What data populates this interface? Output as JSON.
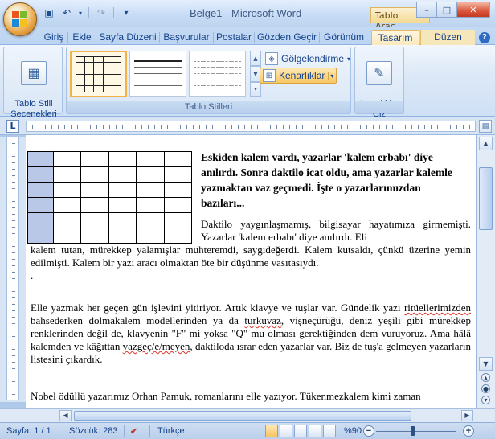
{
  "window": {
    "title": "Belge1 - Microsoft Word",
    "context_title": "Tablo Araç...",
    "min": "–",
    "max": "□",
    "close": "✕"
  },
  "qat": {
    "save_icon": "save-icon",
    "undo_icon": "undo-icon",
    "redo_icon": "redo-icon",
    "customize_icon": "customize-icon"
  },
  "tabs": [
    {
      "label": "Giriş"
    },
    {
      "label": "Ekle"
    },
    {
      "label": "Sayfa Düzeni"
    },
    {
      "label": "Başvurular"
    },
    {
      "label": "Postalar"
    },
    {
      "label": "Gözden Geçir"
    },
    {
      "label": "Görünüm"
    },
    {
      "label": "Tasarım",
      "active": true
    },
    {
      "label": "Düzen"
    }
  ],
  "ribbon": {
    "table_style_options": "Tablo Stili\nSeçenekleri",
    "table_styles_group": "Tablo Stilleri",
    "shading": "Gölgelendirme",
    "borders": "Kenarlıklar",
    "draw_borders": "Kenarlıkları\nÇiz"
  },
  "document": {
    "heading": "Eskiden kalem vardı, yazarlar 'kalem erbabı' diye anılırdı. Sonra daktilo icat oldu, ama yazarlar kalemle yazmaktan vaz geçmedi. İşte o yazarlarımızdan bazıları...",
    "p1a": "Daktilo yaygınlaşmamış, bilgisayar hayatımıza girmemişti. Yazarlar 'kalem erbabı' diye anılırdı. Eli",
    "p1b": "kalem tutan, mürekkep yalamışlar muhteremdi, saygıdeğerdi. Kalem kutsaldı, çünkü üzerine yemin edilmişti. Kalem bir yazı aracı olmaktan öte bir düşünme vasıtasıydı.",
    "p1c": ".",
    "p2_pre": "Elle yazmak her geçen gün işlevini yitiriyor. Artık klavye ve tuşlar var. Gündelik yazı ",
    "p2_sq1": "ritüellerimizden",
    "p2_mid1": " bahsederken dolmakalem modellerinden ya da ",
    "p2_sq2": "turkuvaz",
    "p2_mid2": ", vişneçürüğü, deniz yeşili gibi mürekkep renklerinden değil de, klavyenin \"F\" mi yoksa \"Q\" mu olması gerektiğinden dem vuruyoruz. Ama hâlâ kalemden ve kâğıttan ",
    "p2_sq3": "vazgeç/e/meyen",
    "p2_end": ", daktiloda ısrar eden yazarlar var. Biz de tuş'a gelmeyen yazarların listesini çıkardık.",
    "p3": "Nobel ödüllü yazarımız Orhan Pamuk, romanlarını elle yazıyor. Tükenmezkalem kimi zaman"
  },
  "status": {
    "page": "Sayfa: 1 / 1",
    "words": "Sözcük: 283",
    "language": "Türkçe",
    "zoom": "%90"
  }
}
